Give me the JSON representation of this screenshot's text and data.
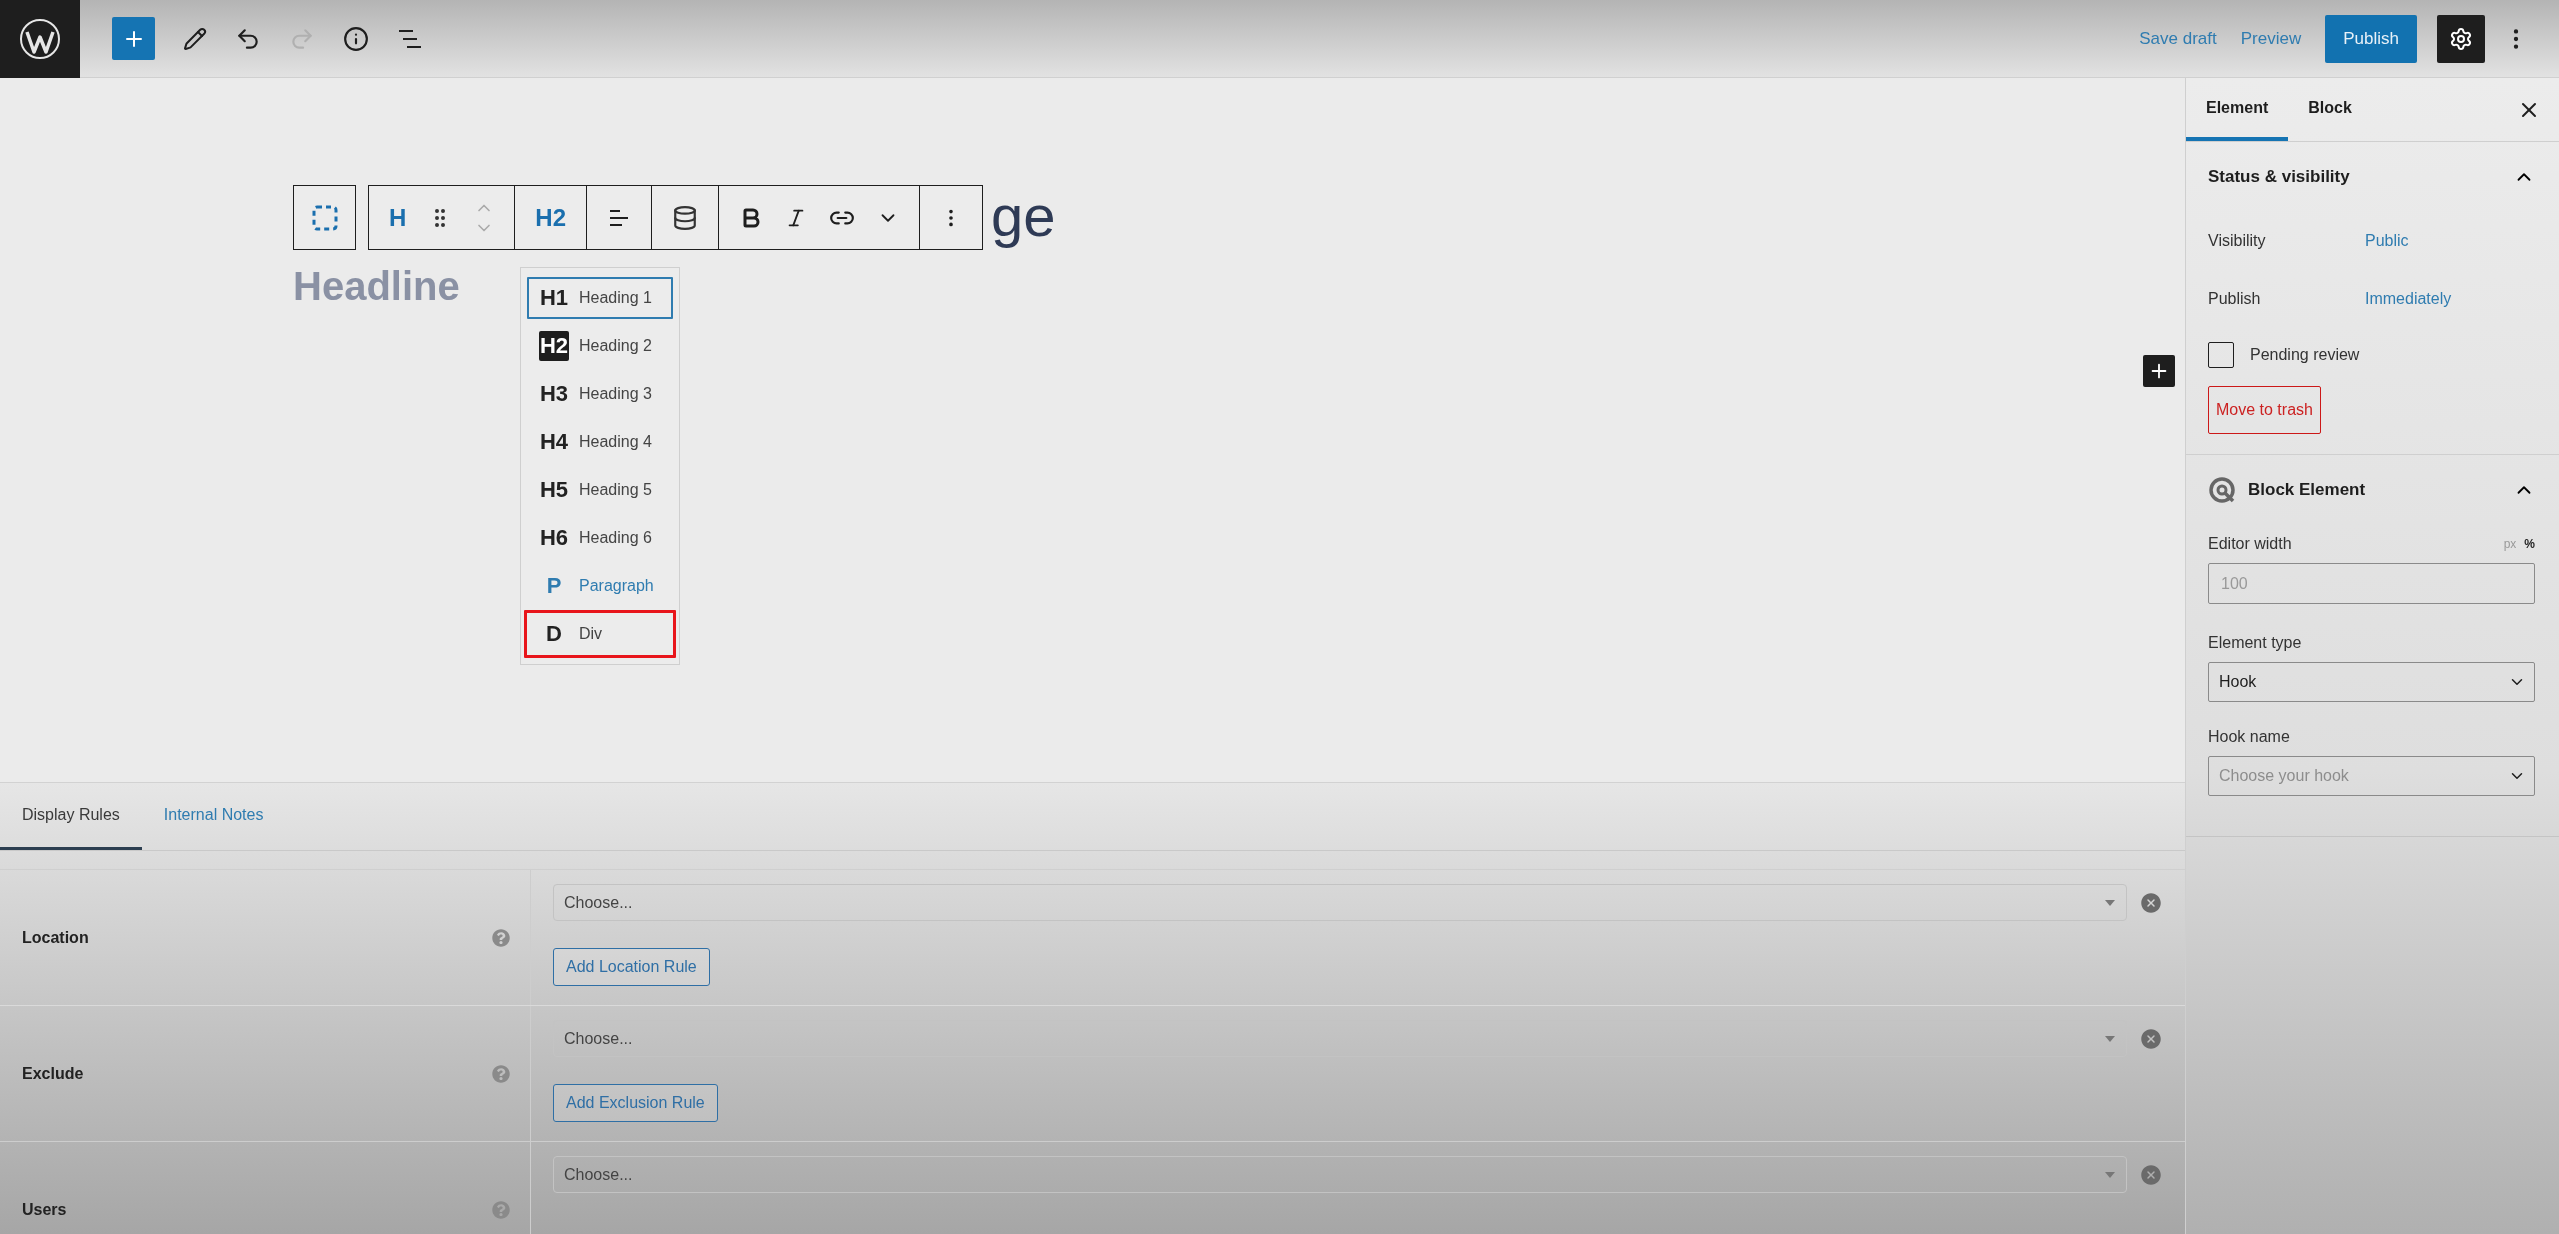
{
  "top_bar": {
    "redo_disabled": true,
    "save_draft": "Save draft",
    "preview": "Preview",
    "publish": "Publish",
    "settings_active": true
  },
  "block_toolbar": {
    "block_letter": "H",
    "tag_button": "H2"
  },
  "heading_fragment": "ge",
  "headline": "Headline",
  "tag_menu": [
    {
      "tag": "H1",
      "label": "Heading 1",
      "focused": true,
      "current": false,
      "hovered": false,
      "highlighted": false
    },
    {
      "tag": "H2",
      "label": "Heading 2",
      "focused": false,
      "current": true,
      "hovered": false,
      "highlighted": false
    },
    {
      "tag": "H3",
      "label": "Heading 3",
      "focused": false,
      "current": false,
      "hovered": false,
      "highlighted": false
    },
    {
      "tag": "H4",
      "label": "Heading 4",
      "focused": false,
      "current": false,
      "hovered": false,
      "highlighted": false
    },
    {
      "tag": "H5",
      "label": "Heading 5",
      "focused": false,
      "current": false,
      "hovered": false,
      "highlighted": false
    },
    {
      "tag": "H6",
      "label": "Heading 6",
      "focused": false,
      "current": false,
      "hovered": false,
      "highlighted": false
    },
    {
      "tag": "P",
      "label": "Paragraph",
      "focused": false,
      "current": false,
      "hovered": true,
      "highlighted": false
    },
    {
      "tag": "D",
      "label": "Div",
      "focused": false,
      "current": false,
      "hovered": false,
      "highlighted": true
    }
  ],
  "bottom_tabs": [
    {
      "label": "Display Rules",
      "selected": true
    },
    {
      "label": "Internal Notes",
      "selected": false
    }
  ],
  "rules": [
    {
      "label": "Location",
      "select": "Choose...",
      "button": "Add Location Rule"
    },
    {
      "label": "Exclude",
      "select": "Choose...",
      "button": "Add Exclusion Rule"
    },
    {
      "label": "Users",
      "select": "Choose..."
    }
  ],
  "sidebar": {
    "tabs": [
      {
        "label": "Element",
        "selected": true
      },
      {
        "label": "Block",
        "selected": false
      }
    ],
    "status": {
      "title": "Status & visibility",
      "expanded": true,
      "rows": [
        {
          "label": "Visibility",
          "value": "Public"
        },
        {
          "label": "Publish",
          "value": "Immediately"
        }
      ],
      "pending_review": {
        "label": "Pending review",
        "checked": false
      },
      "trash": "Move to trash"
    },
    "block_element": {
      "title": "Block Element",
      "expanded": true,
      "editor_width": {
        "label": "Editor width",
        "units": [
          {
            "label": "px",
            "selected": false
          },
          {
            "label": "%",
            "selected": true
          }
        ],
        "placeholder": "100"
      },
      "element_type": {
        "label": "Element type",
        "value": "Hook"
      },
      "hook_name": {
        "label": "Hook name",
        "placeholder": "Choose your hook"
      }
    }
  }
}
